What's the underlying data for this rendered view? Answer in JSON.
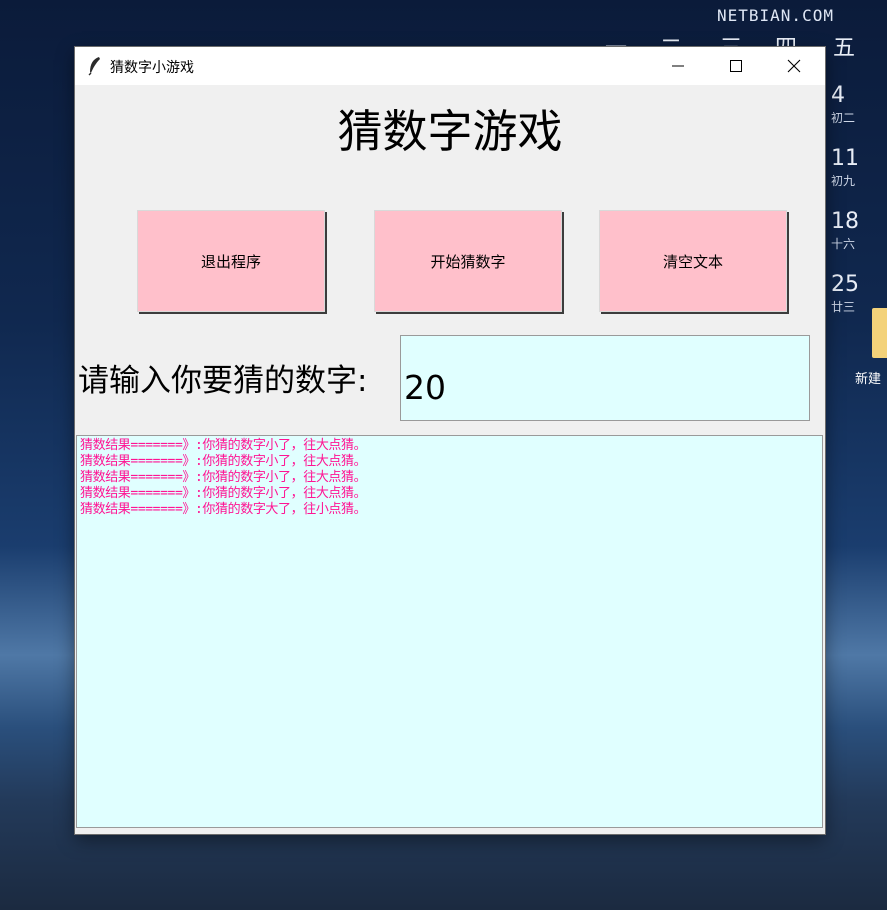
{
  "desktop": {
    "watermark": "NETBIAN.COM",
    "calendar": {
      "weekdays": [
        "一",
        "二",
        "三",
        "四",
        "五"
      ],
      "days": [
        {
          "day": "4",
          "lunar": "初二"
        },
        {
          "day": "11",
          "lunar": "初九"
        },
        {
          "day": "18",
          "lunar": "十六"
        },
        {
          "day": "25",
          "lunar": "廿三"
        }
      ]
    },
    "icon_label": "新建"
  },
  "window": {
    "title": "猜数字小游戏",
    "controls": {
      "minimize": "minimize-icon",
      "maximize": "maximize-icon",
      "close": "close-icon"
    }
  },
  "main": {
    "heading": "猜数字游戏",
    "buttons": {
      "exit": "退出程序",
      "start": "开始猜数字",
      "clear": "清空文本"
    },
    "prompt": "请输入你要猜的数字:",
    "guess_value": "20",
    "log_lines": [
      "猜数结果=======》:你猜的数字小了，往大点猜。",
      "猜数结果=======》:你猜的数字小了，往大点猜。",
      "猜数结果=======》:你猜的数字小了，往大点猜。",
      "猜数结果=======》:你猜的数字小了，往大点猜。",
      "猜数结果=======》:你猜的数字大了，往小点猜。"
    ]
  },
  "colors": {
    "button_bg": "#ffc0cb",
    "field_bg": "#e0ffff",
    "log_text": "#ff1493"
  }
}
